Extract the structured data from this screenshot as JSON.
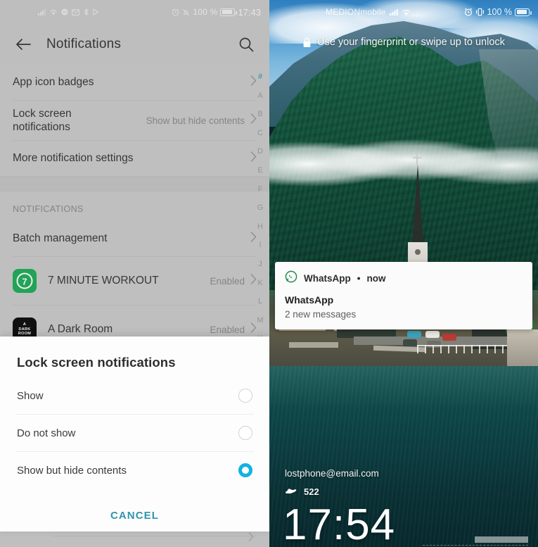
{
  "left_panel": {
    "status_bar": {
      "icons": [
        "signal-icon",
        "wifi-icon",
        "message-icon",
        "email-icon",
        "bluetooth-icon",
        "play-icon"
      ],
      "alarm_icon": "alarm-icon",
      "mute_icon": "bell-off-icon",
      "battery_text": "100 %",
      "time": "17:43"
    },
    "app_bar": {
      "back_icon": "back-arrow-icon",
      "title": "Notifications",
      "search_icon": "search-icon"
    },
    "settings_rows": [
      {
        "label": "App icon badges",
        "value": "",
        "chevron": "chevron-right-icon"
      },
      {
        "label": "Lock screen notifications",
        "value": "Show but hide contents",
        "chevron": "chevron-right-icon"
      },
      {
        "label": "More notification settings",
        "value": "",
        "chevron": "chevron-right-icon"
      }
    ],
    "section_header": "NOTIFICATIONS",
    "batch_row": {
      "label": "Batch management",
      "chevron": "chevron-right-icon"
    },
    "apps": [
      {
        "name": "7 MINUTE WORKOUT",
        "state": "Enabled",
        "icon": "seven-minute-workout-icon",
        "icon_glyph": "7"
      },
      {
        "name": "A Dark Room",
        "state": "Enabled",
        "icon": "a-dark-room-icon",
        "icon_line1": "A",
        "icon_line2": "DARK",
        "icon_line3": "ROOM"
      }
    ],
    "index": [
      "#",
      "A",
      "B",
      "C",
      "D",
      "E",
      "F",
      "G",
      "H",
      "I",
      "J",
      "K",
      "L",
      "M",
      "N"
    ],
    "index_active": "#"
  },
  "dialog": {
    "title": "Lock screen notifications",
    "options": [
      {
        "label": "Show",
        "selected": false
      },
      {
        "label": "Do not show",
        "selected": false
      },
      {
        "label": "Show but hide contents",
        "selected": true
      }
    ],
    "cancel_label": "CANCEL"
  },
  "right_panel": {
    "status_bar": {
      "carrier": "MEDIONmobile",
      "signal_icon": "signal-icon",
      "wifi_icon": "wifi-icon",
      "alarm_icon": "alarm-icon",
      "vibrate_icon": "vibrate-icon",
      "battery_text": "100 %"
    },
    "unlock_hint": {
      "lock_icon": "lock-icon",
      "text": "Use your fingerprint or swipe up to unlock"
    },
    "notification": {
      "app_icon": "whatsapp-icon",
      "app_name": "WhatsApp",
      "separator": "•",
      "time": "now",
      "title": "WhatsApp",
      "body": "2 new messages"
    },
    "owner_email": "lostphone@email.com",
    "steps": {
      "icon": "shoe-icon",
      "count": "522"
    },
    "clock": "17:54"
  },
  "colors": {
    "accent_radio": "#12b2e2",
    "accent_cancel": "#2f96ab",
    "index_active": "#4aa3bd",
    "workout_icon_bg": "#24ad5b",
    "darkroom_icon_bg": "#111111",
    "whatsapp_green": "#258a4f",
    "settings_bg": "#cbcbcb",
    "dialog_bg": "#fdfdfd"
  }
}
